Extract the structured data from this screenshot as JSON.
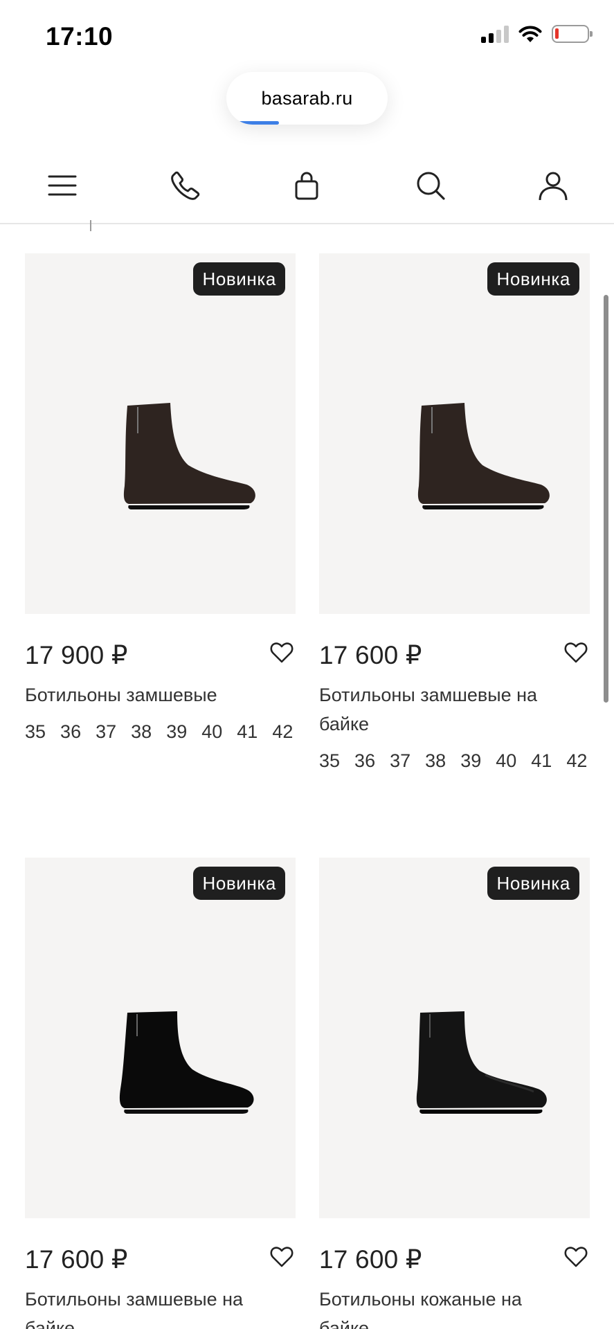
{
  "status_bar": {
    "time": "17:10"
  },
  "browser": {
    "url": "basarab.ru"
  },
  "nav": {
    "icons": [
      "menu-icon",
      "phone-icon",
      "cart-icon",
      "search-icon",
      "account-icon"
    ]
  },
  "products": [
    {
      "badge": "Новинка",
      "price": "17 900 ₽",
      "name": "Ботильоны замшевые",
      "sizes": [
        "35",
        "36",
        "37",
        "38",
        "39",
        "40",
        "41",
        "42"
      ],
      "boot_color": "#2e2420"
    },
    {
      "badge": "Новинка",
      "price": "17 600 ₽",
      "name": "Ботильоны замшевые на байке",
      "sizes": [
        "35",
        "36",
        "37",
        "38",
        "39",
        "40",
        "41",
        "42"
      ],
      "boot_color": "#2e2420"
    },
    {
      "badge": "Новинка",
      "price": "17 600 ₽",
      "name": "Ботильоны замшевые на байке",
      "sizes": [],
      "boot_color": "#0a0a0a"
    },
    {
      "badge": "Новинка",
      "price": "17 600 ₽",
      "name": "Ботильоны кожаные на байке",
      "sizes": [],
      "boot_color": "#141414"
    }
  ],
  "colors": {
    "badge_bg": "#1f1f1f",
    "photo_bg": "#f5f4f3",
    "url_progress": "#3d7fe6"
  }
}
